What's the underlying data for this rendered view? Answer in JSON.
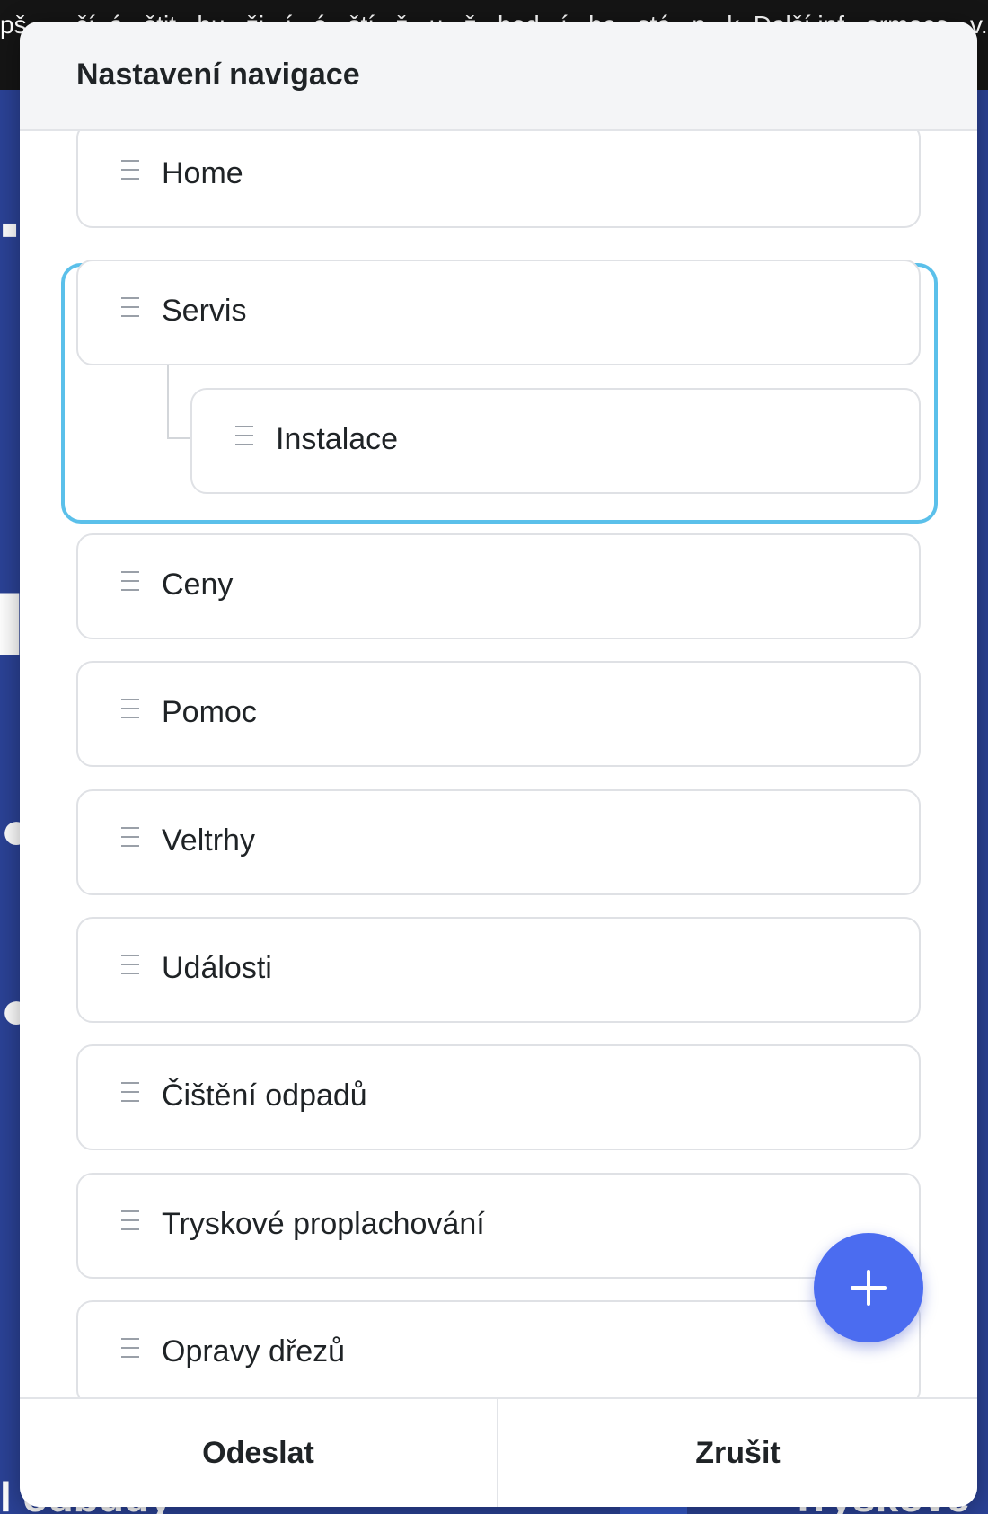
{
  "background": {
    "top_text": "pš... ...čí. á...štit...hu...ži...í...ó...ští...ž...u...ž...hod...í...be...stá...n...k. Další inf...ormace...v...ide...č...níc...h",
    "bottom_left_text": "l odbudy",
    "bottom_right_text": "Tryskové"
  },
  "modal": {
    "title": "Nastavení navigace",
    "items": [
      {
        "label": "Home"
      },
      {
        "label": "Servis"
      },
      {
        "label": "Instalace"
      },
      {
        "label": "Ceny"
      },
      {
        "label": "Pomoc"
      },
      {
        "label": "Veltrhy"
      },
      {
        "label": "Události"
      },
      {
        "label": "Čištění odpadů"
      },
      {
        "label": "Tryskové proplachování"
      },
      {
        "label": "Opravy dřezů"
      }
    ],
    "add_button_icon": "plus-icon",
    "footer": {
      "submit_label": "Odeslat",
      "cancel_label": "Zrušit"
    },
    "colors": {
      "highlight_outline": "#5bc0ea",
      "fab": "#4b6cf0"
    }
  }
}
